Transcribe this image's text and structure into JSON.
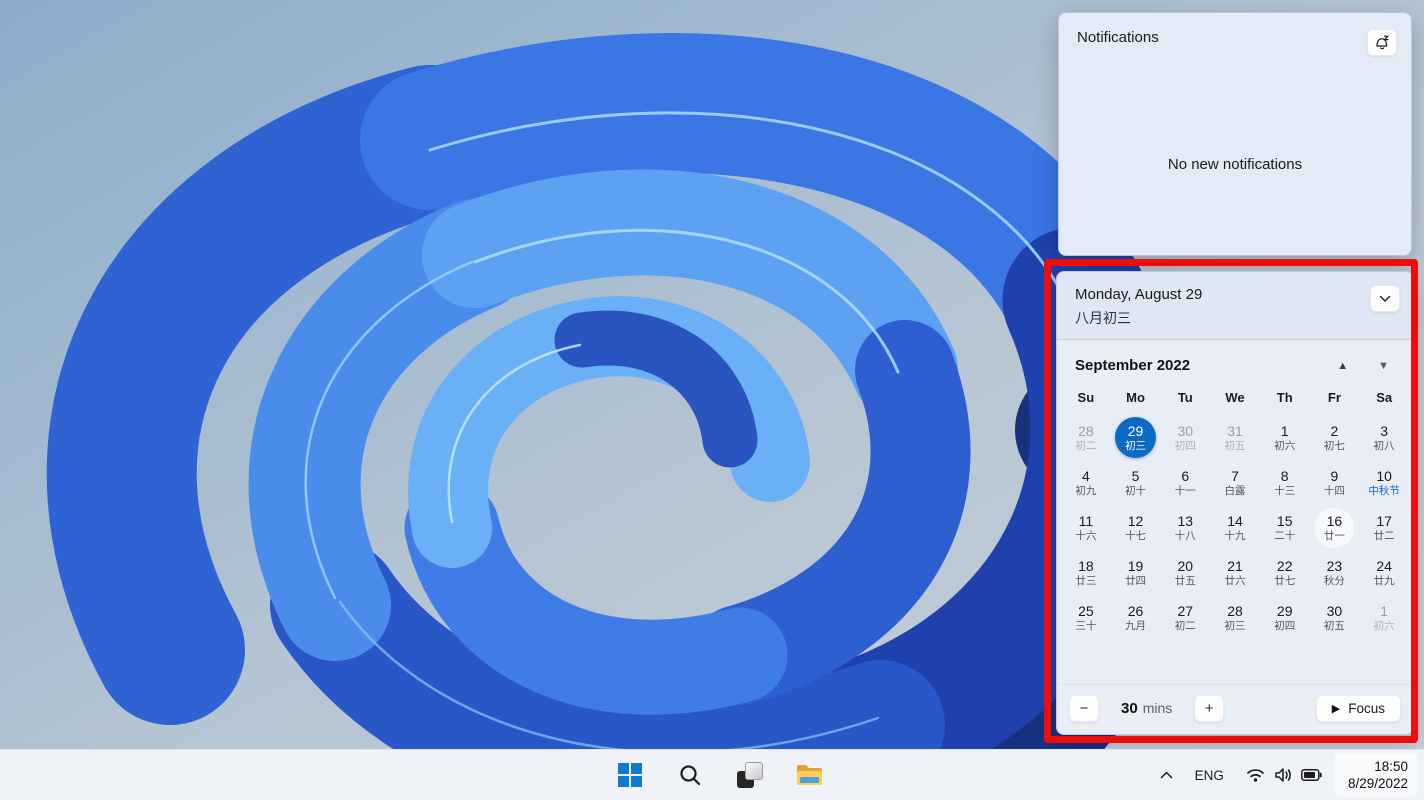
{
  "notifications": {
    "title": "Notifications",
    "empty_text": "No new notifications"
  },
  "calendar": {
    "date_header": {
      "date": "Monday, August 29",
      "lunar": "八月初三"
    },
    "month_label": "September 2022",
    "nav": {
      "prev_icon": "▲",
      "next_icon": "▼"
    },
    "weekdays": [
      "Su",
      "Mo",
      "Tu",
      "We",
      "Th",
      "Fr",
      "Sa"
    ],
    "weeks": [
      [
        {
          "day": "28",
          "lunar": "初二",
          "state": "out"
        },
        {
          "day": "29",
          "lunar": "初三",
          "state": "selected"
        },
        {
          "day": "30",
          "lunar": "初四",
          "state": "out"
        },
        {
          "day": "31",
          "lunar": "初五",
          "state": "out"
        },
        {
          "day": "1",
          "lunar": "初六",
          "state": "normal"
        },
        {
          "day": "2",
          "lunar": "初七",
          "state": "normal"
        },
        {
          "day": "3",
          "lunar": "初八",
          "state": "normal"
        }
      ],
      [
        {
          "day": "4",
          "lunar": "初九",
          "state": "normal"
        },
        {
          "day": "5",
          "lunar": "初十",
          "state": "normal"
        },
        {
          "day": "6",
          "lunar": "十一",
          "state": "normal"
        },
        {
          "day": "7",
          "lunar": "白露",
          "state": "normal"
        },
        {
          "day": "8",
          "lunar": "十三",
          "state": "normal"
        },
        {
          "day": "9",
          "lunar": "十四",
          "state": "normal"
        },
        {
          "day": "10",
          "lunar": "中秋节",
          "state": "holiday"
        }
      ],
      [
        {
          "day": "11",
          "lunar": "十六",
          "state": "normal"
        },
        {
          "day": "12",
          "lunar": "十七",
          "state": "normal"
        },
        {
          "day": "13",
          "lunar": "十八",
          "state": "normal"
        },
        {
          "day": "14",
          "lunar": "十九",
          "state": "normal"
        },
        {
          "day": "15",
          "lunar": "二十",
          "state": "normal"
        },
        {
          "day": "16",
          "lunar": "廿一",
          "state": "hovered"
        },
        {
          "day": "17",
          "lunar": "廿二",
          "state": "normal"
        }
      ],
      [
        {
          "day": "18",
          "lunar": "廿三",
          "state": "normal"
        },
        {
          "day": "19",
          "lunar": "廿四",
          "state": "normal"
        },
        {
          "day": "20",
          "lunar": "廿五",
          "state": "normal"
        },
        {
          "day": "21",
          "lunar": "廿六",
          "state": "normal"
        },
        {
          "day": "22",
          "lunar": "廿七",
          "state": "normal"
        },
        {
          "day": "23",
          "lunar": "秋分",
          "state": "normal"
        },
        {
          "day": "24",
          "lunar": "廿九",
          "state": "normal"
        }
      ],
      [
        {
          "day": "25",
          "lunar": "三十",
          "state": "normal"
        },
        {
          "day": "26",
          "lunar": "九月",
          "state": "normal"
        },
        {
          "day": "27",
          "lunar": "初二",
          "state": "normal"
        },
        {
          "day": "28",
          "lunar": "初三",
          "state": "normal"
        },
        {
          "day": "29",
          "lunar": "初四",
          "state": "normal"
        },
        {
          "day": "30",
          "lunar": "初五",
          "state": "normal"
        },
        {
          "day": "1",
          "lunar": "初六",
          "state": "out"
        }
      ]
    ],
    "focus": {
      "minus_label": "−",
      "duration": "30",
      "unit": "mins",
      "plus_label": "+",
      "play_icon": "▶",
      "button_label": "Focus"
    }
  },
  "taskbar": {
    "tray": {
      "language": "ENG",
      "time": "18:50",
      "date": "8/29/2022"
    }
  },
  "colors": {
    "accent": "#0b6ac2",
    "holiday_text": "#0b6ac2",
    "annotation_red": "#ee0d0d",
    "taskbar_bg": "#eff2f7",
    "panel_bg": "#e9eef6"
  }
}
